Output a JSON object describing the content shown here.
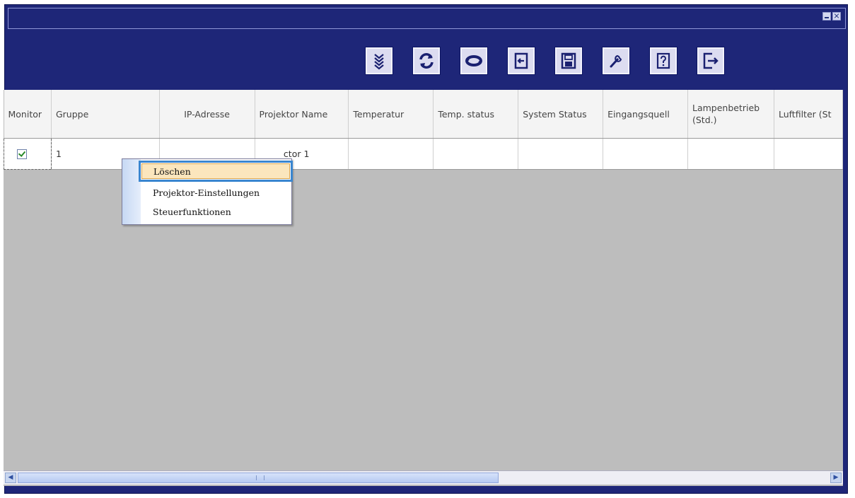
{
  "window": {
    "controls": [
      "minimize-icon",
      "close-icon"
    ]
  },
  "toolbar": {
    "buttons": [
      {
        "name": "expand-down-icon"
      },
      {
        "name": "refresh-icon"
      },
      {
        "name": "sync-icon"
      },
      {
        "name": "import-icon"
      },
      {
        "name": "save-disk-icon"
      },
      {
        "name": "wrench-icon"
      },
      {
        "name": "help-icon"
      },
      {
        "name": "exit-icon"
      }
    ]
  },
  "table": {
    "columns": [
      "Monitor",
      "Gruppe",
      "IP-Adresse",
      "Projektor Name",
      "Temperatur",
      "Temp. status",
      "System Status",
      "Eingangsquell",
      "Lampenbetrieb (Std.)",
      "Luftfilter (St"
    ],
    "rows": [
      {
        "monitor_checked": true,
        "gruppe": "1",
        "ip": "",
        "name": "ctor 1",
        "temperatur": "",
        "temp_status": "",
        "system_status": "",
        "eingang": "",
        "lampe": "",
        "luft": ""
      }
    ]
  },
  "context_menu": {
    "items": [
      "Löschen",
      "Projektor-Einstellungen",
      "Steuerfunktionen"
    ],
    "highlighted": "Löschen"
  },
  "colors": {
    "title_bar": "#1e2678",
    "content_bg": "#bdbdbd",
    "highlight": "#fbe6bd",
    "focus_outline": "#3a86d0"
  }
}
